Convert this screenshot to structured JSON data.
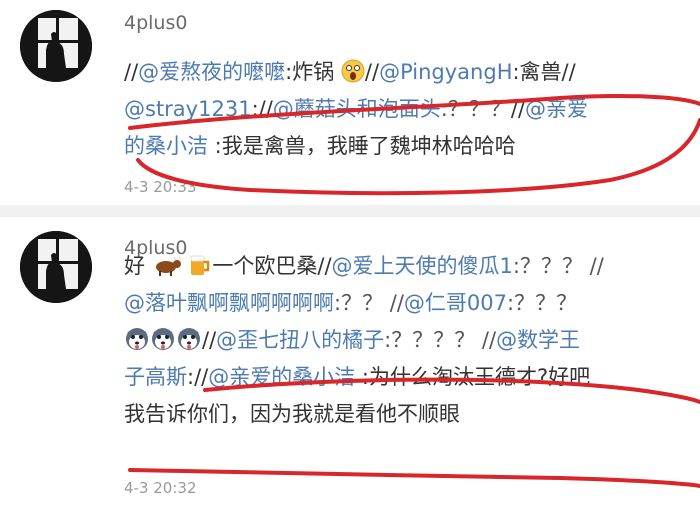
{
  "posts": [
    {
      "username": "4plus0",
      "lines": [
        [
          "//",
          "@爱熬夜的嚒嚒",
          ":炸锅",
          "//",
          "@PingyangH",
          ":禽兽//"
        ],
        [
          "@stray1231",
          ":",
          "//",
          "@蘑菇头和泡面头",
          ":？？？",
          "//",
          "@亲爱"
        ],
        [
          "的桑小洁",
          " :我是禽兽，我睡了魏坤林哈哈哈"
        ]
      ],
      "time": "4-3 20:33"
    },
    {
      "username": "4plus0",
      "lines": [
        [
          "好",
          "一个欧巴桑//",
          "@爱上天使的傻瓜1",
          ":？？？ //"
        ],
        [
          "@落叶飘啊飘啊啊啊啊",
          ":？？ //",
          "@仁哥007",
          ":？？？"
        ],
        [
          "//",
          "@歪七扭八的橘子",
          ":？？？？ //",
          "@数学王"
        ],
        [
          "子高斯",
          ":",
          "//",
          "@亲爱的桑小洁",
          " :为什么淘汰王德才?好吧"
        ],
        [
          "我告诉你们，因为我就是看他不顺眼"
        ]
      ],
      "time": "4-3 20:32"
    }
  ],
  "icons": {
    "avatar": "window-silhouette-avatar",
    "shock_emoji": "shocked-face-emoji",
    "cow_emoji": "cow-emoji",
    "beer_emoji": "beer-mug-emoji",
    "dog_emoji": "husky-dog-emoji"
  },
  "colors": {
    "mention": "#4d7bb0",
    "annotation": "#d8262a",
    "text": "#333333",
    "meta": "#9a9a9a"
  }
}
